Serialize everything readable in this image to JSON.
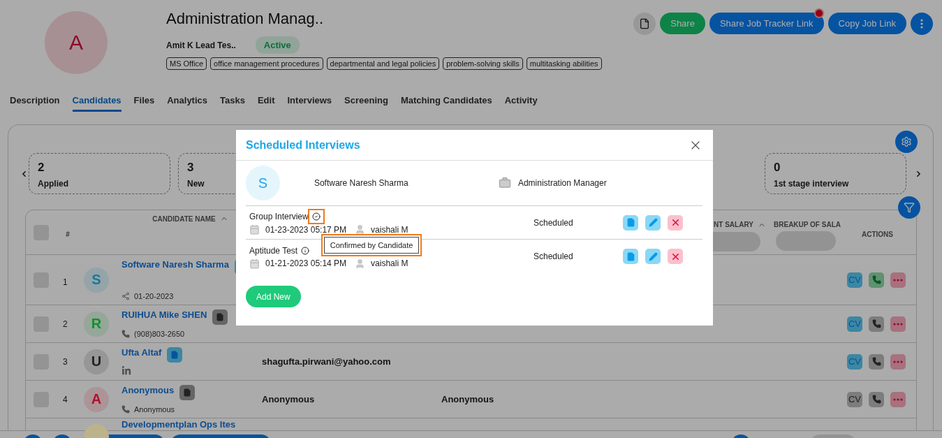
{
  "job": {
    "avatar": "A",
    "title": "Administration Manag..",
    "owner": "Amit K Lead Tes..",
    "status": "Active",
    "skills": [
      "MS Office",
      "office management procedures",
      "departmental and legal policies",
      "problem-solving skills",
      "multitasking abilities"
    ]
  },
  "header_actions": [
    {
      "kind": "icon"
    },
    {
      "kind": "share",
      "label": "Share",
      "alert": false
    },
    {
      "kind": "link",
      "label": "Share Job Tracker Link",
      "alert": true
    },
    {
      "kind": "link",
      "label": "Copy Job Link",
      "alert": false
    },
    {
      "kind": "menu"
    }
  ],
  "tabs": [
    {
      "label": "Description",
      "selected": false
    },
    {
      "label": "Candidates",
      "selected": true
    },
    {
      "label": "Files",
      "selected": false
    },
    {
      "label": "Analytics",
      "selected": false
    },
    {
      "label": "Tasks",
      "selected": false
    },
    {
      "label": "Edit",
      "selected": false
    },
    {
      "label": "Interviews",
      "selected": false
    },
    {
      "label": "Screening",
      "selected": false
    },
    {
      "label": "Matching Candidates",
      "selected": false
    },
    {
      "label": "Activity",
      "selected": false
    }
  ],
  "stages": [
    {
      "count": "2",
      "label": "Applied"
    },
    {
      "count": "3",
      "label": "New"
    },
    {
      "count": "0",
      "label": "1st stage interview"
    }
  ],
  "table": {
    "all_checked": false,
    "columns": [
      {
        "kind": "checkbox"
      },
      {
        "kind": "text",
        "label": "#"
      },
      {
        "kind": "blank"
      },
      {
        "kind": "sort",
        "label": "CANDIDATE NAME"
      },
      {
        "kind": "blank"
      },
      {
        "kind": "blank"
      },
      {
        "kind": "sortfilter",
        "label": "NT SALARY"
      },
      {
        "kind": "filter",
        "label": "BREAKUP OF SALA"
      },
      {
        "kind": "text",
        "label": "ACTIONS"
      }
    ],
    "rows": [
      {
        "checked": false,
        "num": "1",
        "initial": "S",
        "color": "#127a9a",
        "name": "Software Naresh Sharma",
        "resume_uploaded": true,
        "sub": {
          "kind": "share",
          "text": "01-20-2023"
        },
        "cv": {
          "label": "CV",
          "active": true
        },
        "call_active": true
      },
      {
        "checked": false,
        "num": "2",
        "initial": "R",
        "color": "#11902f",
        "name": "RUIHUA Mike SHEN",
        "resume_uploaded": false,
        "sub": {
          "kind": "phone",
          "text": "(908)803-2650"
        },
        "cv": {
          "label": "CV",
          "active": true
        },
        "call_active": false
      },
      {
        "checked": false,
        "num": "3",
        "initial": "U",
        "color": "#222222",
        "name": "Ufta Altaf",
        "resume_uploaded": true,
        "sub": {
          "kind": "linkedin"
        },
        "email": "shagufta.pirwani@yahoo.com",
        "cv": {
          "label": "CV",
          "active": true
        },
        "call_active": false
      },
      {
        "checked": false,
        "num": "4",
        "initial": "A",
        "color": "#b0102a",
        "name": "Anonymous",
        "resume_uploaded": false,
        "sub": {
          "kind": "phone",
          "text": "Anonymous"
        },
        "email": "Anonymous",
        "phone": "Anonymous",
        "cv": {
          "label": "CV",
          "active": false
        },
        "call_active": false
      },
      {
        "color": "#bcb28c",
        "name": "Developmentplan Ops Ites"
      }
    ]
  },
  "modal": {
    "title": "Scheduled Interviews",
    "candidate_initial": "S",
    "candidate": "Software Naresh Sharma",
    "job": "Administration Manager",
    "interviews": [
      {
        "title": "Group Interview",
        "confirmed": true,
        "highlighted": true,
        "tooltip": "Confirmed by Candidate",
        "date": "01-23-2023 05:17 PM",
        "interviewer": "vaishali M",
        "status": "Scheduled"
      },
      {
        "title": "Aptitude Test",
        "confirmed": false,
        "highlighted": false,
        "date": "01-21-2023 05:14 PM",
        "interviewer": "vaishali M",
        "status": "Scheduled"
      }
    ],
    "add_label": "Add New"
  }
}
